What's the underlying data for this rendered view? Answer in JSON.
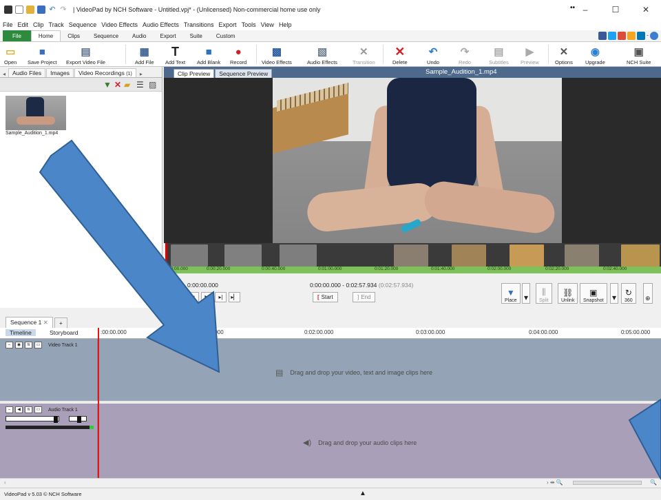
{
  "window": {
    "title": "| VideoPad by NCH Software - Untitled.vpj* - (Unlicensed) Non-commercial home use only",
    "dots": "••",
    "minimize": "–",
    "maximize": "☐",
    "close": "✕"
  },
  "menu": [
    "File",
    "Edit",
    "Clip",
    "Track",
    "Sequence",
    "Video Effects",
    "Audio Effects",
    "Transitions",
    "Export",
    "Tools",
    "View",
    "Help"
  ],
  "ribbon_tabs": [
    "File",
    "Home",
    "Clips",
    "Sequence",
    "Audio",
    "Export",
    "Suite",
    "Custom"
  ],
  "ribbon": {
    "open": "Open",
    "save_project": "Save Project",
    "export_video_file": "Export Video File",
    "add_file": "Add File",
    "add_text": "Add Text",
    "add_blank": "Add Blank",
    "record": "Record",
    "video_effects": "Video Effects",
    "audio_effects": "Audio Effects",
    "transition": "Transition",
    "delete": "Delete",
    "undo": "Undo",
    "redo": "Redo",
    "subtitles": "Subtitles",
    "preview": "Preview",
    "options": "Options",
    "upgrade": "Upgrade",
    "nch_suite": "NCH Suite"
  },
  "bin": {
    "tabs": [
      "Audio Files",
      "Images",
      "Video Recordings"
    ],
    "count_badge": "(1)",
    "item_label": "Sample_Audition_1.mp4"
  },
  "preview": {
    "tabs": [
      "Clip Preview",
      "Sequence Preview"
    ],
    "title": "Sample_Audition_1.mp4",
    "ruler_ticks": [
      "00:00.000",
      "0:00:20.000",
      "0:00:40.000",
      "0:01:00.000",
      "0:01:20.000",
      "0:01:40.000",
      "0:02:00.000",
      "0:02:20.000",
      "0:02:40.000"
    ],
    "current_time": "0:00:00.000",
    "range": "0:00:00.000 - 0:02:57.934",
    "range_duration": "(0:02:57.934)",
    "start_label": "Start",
    "end_label": "End",
    "place": "Place",
    "split": "Split",
    "unlink": "Unlink",
    "snapshot": "Snapshot",
    "v360": "360"
  },
  "sequence": {
    "tab": "Sequence 1",
    "tab_close": "✕",
    "add_tab": "+",
    "mode_timeline": "Timeline",
    "mode_storyboard": "Storyboard",
    "ticks": [
      ":00:00.000",
      ":00.000",
      "0:02:00.000",
      "0:03:00.000",
      "0:04:00.000",
      "0:05:00.000"
    ],
    "video_track_name": "Video Track 1",
    "video_hint": "Drag and drop your video, text and image clips here",
    "audio_track_name": "Audio Track 1",
    "audio_hint": "Drag and drop your audio clips here"
  },
  "status": {
    "text": "VideoPad v 5.03 © NCH Software"
  },
  "colors": {
    "accent_green": "#2e8b3e",
    "preview_header": "#4d6a8c",
    "video_track": "#94a3b5",
    "audio_track": "#a99fb8",
    "arrow_fill": "#4a86c8",
    "arrow_stroke": "#2f5f93"
  }
}
